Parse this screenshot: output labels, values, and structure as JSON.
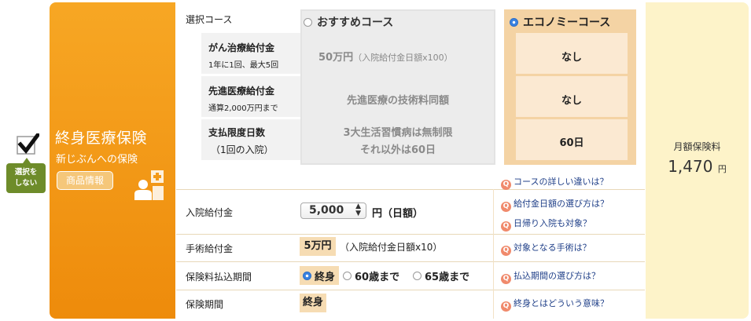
{
  "select_column": {
    "deselect_label_line1": "選択を",
    "deselect_label_line2": "しない"
  },
  "product": {
    "title": "終身医療保険",
    "subtitle": "新じぶんへの保険",
    "info_button": "商品情報"
  },
  "course_table": {
    "header_label": "選択コース",
    "recommend_course": "おすすめコース",
    "economy_course": "エコノミーコース",
    "rows": [
      {
        "label": "がん治療給付金",
        "sub": "1年に1回、最大5回",
        "recommend_main": "50万円",
        "recommend_sub": "（入院給付金日額x100）",
        "economy": "なし"
      },
      {
        "label": "先進医療給付金",
        "sub": "通算2,000万円まで",
        "recommend_main": "先進医療の技術料同額",
        "economy": "なし"
      },
      {
        "label": "支払限度日数",
        "sub": "（1回の入院）",
        "recommend_line1": "3大生活習慣病は無制限",
        "recommend_line2": "それ以外は60日",
        "economy": "60日"
      }
    ],
    "course_link": "コースの詳しい違いは？"
  },
  "hospital_benefit": {
    "label": "入院給付金",
    "select_value": "5,000",
    "unit": "円（日額）",
    "links": [
      "給付金日額の選び方は？",
      "日帰り入院も対象？"
    ]
  },
  "surgery_benefit": {
    "label": "手術給付金",
    "value": "5万円",
    "note": "（入院給付金日額x10）",
    "link": "対象となる手術は？"
  },
  "payment_period": {
    "label": "保険料払込期間",
    "options": [
      "終身",
      "60歳まで",
      "65歳まで"
    ],
    "selected": "終身",
    "link": "払込期間の選び方は？"
  },
  "insurance_period": {
    "label": "保険期間",
    "value": "終身",
    "link": "終身とはどういう意味？"
  },
  "premium": {
    "label": "月額保険料",
    "value": "1,470",
    "unit": "円"
  },
  "icons": [
    "checkmark-icon",
    "person-hospital-icon",
    "question-icon",
    "radio-icon"
  ],
  "colors": {
    "orange": "#f39a19",
    "green": "#6e8c2a",
    "economy": "#f4d3a4",
    "premium_bg": "#fdf3c9",
    "link": "#1f3f88"
  }
}
